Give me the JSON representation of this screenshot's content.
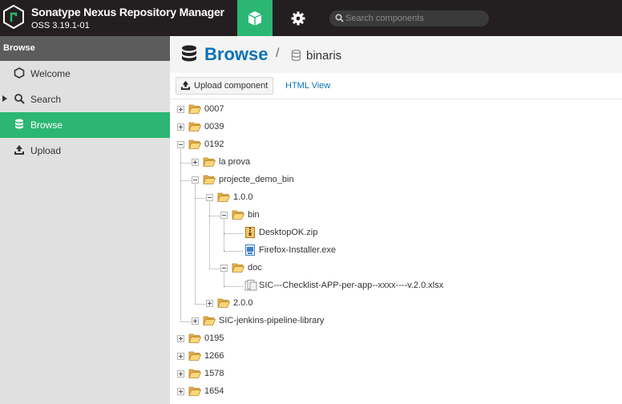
{
  "app": {
    "title": "Sonatype Nexus Repository Manager",
    "version": "OSS 3.19.1-01",
    "brand_color": "#2bb673",
    "link_color": "#0b73b5"
  },
  "search": {
    "placeholder": "Search components"
  },
  "sidebar": {
    "heading": "Browse",
    "items": [
      {
        "label": "Welcome",
        "icon": "hexagon-icon",
        "active": false
      },
      {
        "label": "Search",
        "icon": "search-icon",
        "active": false
      },
      {
        "label": "Browse",
        "icon": "database-icon",
        "active": true
      },
      {
        "label": "Upload",
        "icon": "upload-icon",
        "active": false
      }
    ]
  },
  "main": {
    "title": "Browse",
    "breadcrumb_separator": "/",
    "repository": "binaris",
    "upload_button": "Upload component",
    "html_view": "HTML View"
  },
  "tree": [
    {
      "label": "0007",
      "type": "folder",
      "state": "collapsed",
      "depth": 0
    },
    {
      "label": "0039",
      "type": "folder",
      "state": "collapsed",
      "depth": 0
    },
    {
      "label": "0192",
      "type": "folder",
      "state": "expanded",
      "depth": 0
    },
    {
      "label": "la prova",
      "type": "folder",
      "state": "collapsed",
      "depth": 1
    },
    {
      "label": "projecte_demo_bin",
      "type": "folder",
      "state": "expanded",
      "depth": 1
    },
    {
      "label": "1.0.0",
      "type": "folder",
      "state": "expanded",
      "depth": 2
    },
    {
      "label": "bin",
      "type": "folder",
      "state": "expanded",
      "depth": 3
    },
    {
      "label": "DesktopOK.zip",
      "type": "zip",
      "state": "leaf",
      "depth": 4
    },
    {
      "label": "Firefox-Installer.exe",
      "type": "exe",
      "state": "leaf",
      "depth": 4
    },
    {
      "label": "doc",
      "type": "folder",
      "state": "expanded",
      "depth": 3
    },
    {
      "label": "SIC---Checklist-APP-per-app--xxxx----v.2.0.xlsx",
      "type": "file",
      "state": "leaf",
      "depth": 4
    },
    {
      "label": "2.0.0",
      "type": "folder",
      "state": "collapsed",
      "depth": 2
    },
    {
      "label": "SIC-jenkins-pipeline-library",
      "type": "folder",
      "state": "collapsed",
      "depth": 1
    },
    {
      "label": "0195",
      "type": "folder",
      "state": "collapsed",
      "depth": 0
    },
    {
      "label": "1266",
      "type": "folder",
      "state": "collapsed",
      "depth": 0
    },
    {
      "label": "1578",
      "type": "folder",
      "state": "collapsed",
      "depth": 0
    },
    {
      "label": "1654",
      "type": "folder",
      "state": "collapsed",
      "depth": 0
    }
  ]
}
